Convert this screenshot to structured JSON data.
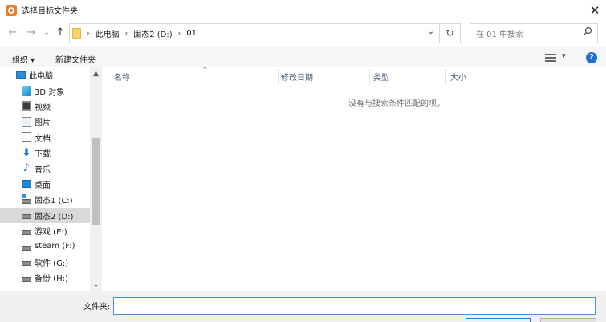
{
  "window": {
    "title": "选择目标文件夹",
    "close_glyph": "✕"
  },
  "nav": {
    "back_glyph": "←",
    "forward_glyph": "→",
    "recent_glyph": "⌄",
    "up_glyph": "↑"
  },
  "address": {
    "breadcrumbs": [
      "此电脑",
      "固态2 (D:)",
      "01"
    ],
    "sep_glyph": "›",
    "dropdown_glyph": "⌄",
    "refresh_glyph": "↻"
  },
  "search": {
    "placeholder": "在 01 中搜索",
    "icon": "search-icon"
  },
  "toolbar": {
    "organize": "组织 ▾",
    "new_folder": "新建文件夹",
    "view_dropdown": "▾",
    "help": "?"
  },
  "sidebar": {
    "items": [
      {
        "label": "此电脑",
        "icon": "computer-icon"
      },
      {
        "label": "3D 对象",
        "icon": "3d-objects-icon"
      },
      {
        "label": "视频",
        "icon": "video-icon"
      },
      {
        "label": "图片",
        "icon": "pictures-icon"
      },
      {
        "label": "文档",
        "icon": "documents-icon"
      },
      {
        "label": "下载",
        "icon": "download-icon"
      },
      {
        "label": "音乐",
        "icon": "music-icon"
      },
      {
        "label": "桌面",
        "icon": "desktop-icon"
      },
      {
        "label": "固态1 (C:)",
        "icon": "system-drive-icon"
      },
      {
        "label": "固态2 (D:)",
        "icon": "drive-icon",
        "selected": true
      },
      {
        "label": "游戏 (E:)",
        "icon": "drive-icon"
      },
      {
        "label": "steam (F:)",
        "icon": "drive-icon"
      },
      {
        "label": "软件 (G:)",
        "icon": "drive-icon"
      },
      {
        "label": "备份 (H:)",
        "icon": "drive-icon"
      }
    ],
    "scroll_up_glyph": "▲",
    "scroll_down_glyph": "⌄",
    "download_glyph": "⬇",
    "music_glyph": "♪"
  },
  "content": {
    "columns": [
      "名称",
      "修改日期",
      "类型",
      "大小"
    ],
    "sort_glyph": "^",
    "empty_message": "没有与搜索条件匹配的项。"
  },
  "footer": {
    "filename_label": "文件夹:",
    "filename_value": ""
  },
  "colors": {
    "accent": "#1f6fd1",
    "selection": "#d9d9d9",
    "toolbar_bg": "#f5f6f7",
    "footer_bg": "#f0f0f0"
  }
}
